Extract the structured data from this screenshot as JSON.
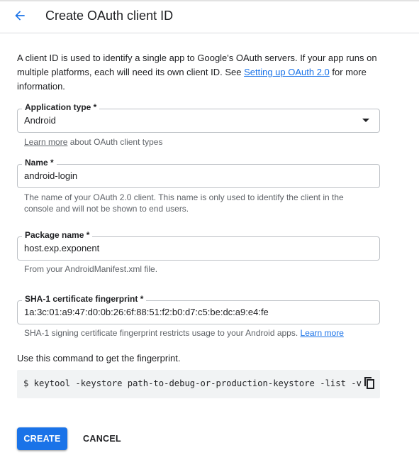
{
  "header": {
    "title": "Create OAuth client ID",
    "back_icon": "arrow-back-icon"
  },
  "intro": {
    "text_before": "A client ID is used to identify a single app to Google's OAuth servers. If your app runs on multiple platforms, each will need its own client ID. See ",
    "link": "Setting up OAuth 2.0",
    "text_after": " for more information."
  },
  "application_type": {
    "label": "Application type *",
    "value": "Android",
    "dropdown_icon": "dropdown-arrow-icon",
    "helper_link": "Learn more",
    "helper_text": " about OAuth client types"
  },
  "name": {
    "label": "Name *",
    "value": "android-login",
    "helper": "The name of your OAuth 2.0 client. This name is only used to identify the client in the console and will not be shown to end users."
  },
  "package_name": {
    "label": "Package name *",
    "value": "host.exp.exponent",
    "helper": "From your AndroidManifest.xml file."
  },
  "sha1": {
    "label": "SHA-1 certificate fingerprint *",
    "value": "1a:3c:01:a9:47:d0:0b:26:6f:88:51:f2:b0:d7:c5:be:dc:a9:e4:fe",
    "helper_text": "SHA-1 signing certificate fingerprint restricts usage to your Android apps. ",
    "helper_link": "Learn more"
  },
  "command": {
    "label": "Use this command to get the fingerprint.",
    "code": "$ keytool -keystore path-to-debug-or-production-keystore -list -v",
    "copy_icon": "copy-icon"
  },
  "actions": {
    "create": "CREATE",
    "cancel": "CANCEL"
  },
  "colors": {
    "accent": "#1a73e8",
    "border": "#bdc1c6",
    "helper_text": "#5f6368",
    "code_background": "#f1f3f4"
  }
}
